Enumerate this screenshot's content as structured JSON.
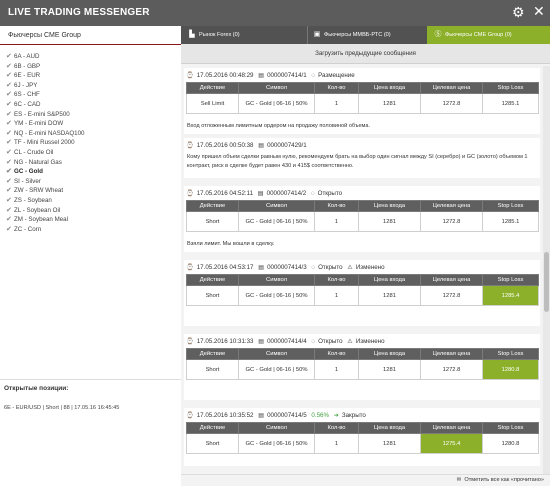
{
  "window": {
    "title": "LIVE TRADING MESSENGER"
  },
  "sidebar": {
    "title": "Фьючерсы CME Group",
    "items": [
      {
        "label": "6A - AUD"
      },
      {
        "label": "6B - GBP"
      },
      {
        "label": "6E - EUR"
      },
      {
        "label": "6J - JPY"
      },
      {
        "label": "6S - CHF"
      },
      {
        "label": "6C - CAD"
      },
      {
        "label": "ES - E-mini S&P500"
      },
      {
        "label": "YM - E-mini DOW"
      },
      {
        "label": "NQ - E-mini NASDAQ100"
      },
      {
        "label": "TF - Mini Russel 2000"
      },
      {
        "label": "CL - Crude Oil"
      },
      {
        "label": "NG - Natural Gas"
      },
      {
        "label": "GC - Gold"
      },
      {
        "label": "SI - Silver"
      },
      {
        "label": "ZW - SRW Wheat"
      },
      {
        "label": "ZS - Soybean"
      },
      {
        "label": "ZL - Soybean Oil"
      },
      {
        "label": "ZM - Soybean Meal"
      },
      {
        "label": "ZC - Corn"
      }
    ],
    "open_positions_title": "Открытые позиции:",
    "open_position": "6E - EUR/USD | Short | 88 | 17.05.16 16:45:45"
  },
  "tabs": [
    {
      "label": "Рынок Forex (0)",
      "icon": "chart-icon"
    },
    {
      "label": "Фьючерсы ММВБ-РТС (0)",
      "icon": "briefcase-icon"
    },
    {
      "label": "Фьючерсы CME Group (0)",
      "icon": "dollar-icon"
    }
  ],
  "load_previous": "Загрузить предыдущие сообщения",
  "table_headers": [
    "Действие",
    "Символ",
    "Кол-во",
    "Цена входа",
    "Целевая цена",
    "Stop Loss"
  ],
  "messages": [
    {
      "datetime": "17.05.2016 00:48:29",
      "id": "0000007414/1",
      "status": "Размещение",
      "row": [
        "Sell Limit",
        "GC - Gold | 06-16 | 50%",
        "1",
        "1281",
        "1272.8",
        "1285.1"
      ],
      "text": "Вход отложенным лимитным ордером на продажу половиной объема."
    },
    {
      "datetime": "17.05.2016 00:50:38",
      "id": "0000007429/1",
      "text": "Кому пришел объем сделки равным нулю, рекомендуем брать на выбор один сигнал между SI (серебро) и GC (золото) объемом 1 контракт, риск в сделке будет равен 430 и 415$ соответственно."
    },
    {
      "datetime": "17.05.2016 04:52:11",
      "id": "0000007414/2",
      "status": "Открыто",
      "row": [
        "Short",
        "GC - Gold | 06-16 | 50%",
        "1",
        "1281",
        "1272.8",
        "1285.1"
      ],
      "text": "Взяли лимит. Мы вошли в сделку."
    },
    {
      "datetime": "17.05.2016 04:53:17",
      "id": "0000007414/3",
      "status": "Открыто",
      "changed": "Изменено",
      "row": [
        "Short",
        "GC - Gold | 06-16 | 50%",
        "1",
        "1281",
        "1272.8",
        "1285.4"
      ]
    },
    {
      "datetime": "17.05.2016 10:31:33",
      "id": "0000007414/4",
      "status": "Открыто",
      "changed": "Изменено",
      "row": [
        "Short",
        "GC - Gold | 06-16 | 50%",
        "1",
        "1281",
        "1272.8",
        "1280.8"
      ]
    },
    {
      "datetime": "17.05.2016 10:35:52",
      "id": "0000007414/5",
      "profit": "0.56%",
      "status": "Закрыто",
      "row": [
        "Short",
        "GC - Gold | 06-16 | 50%",
        "1",
        "1281",
        "1275.4",
        "1280.8"
      ]
    }
  ],
  "footer": {
    "mark_all_read": "Отметить все как «прочитано»"
  },
  "colors": {
    "accent": "#8cb02a",
    "header_bg": "#5c5c5c",
    "sidebar_sep": "#8a1818"
  }
}
